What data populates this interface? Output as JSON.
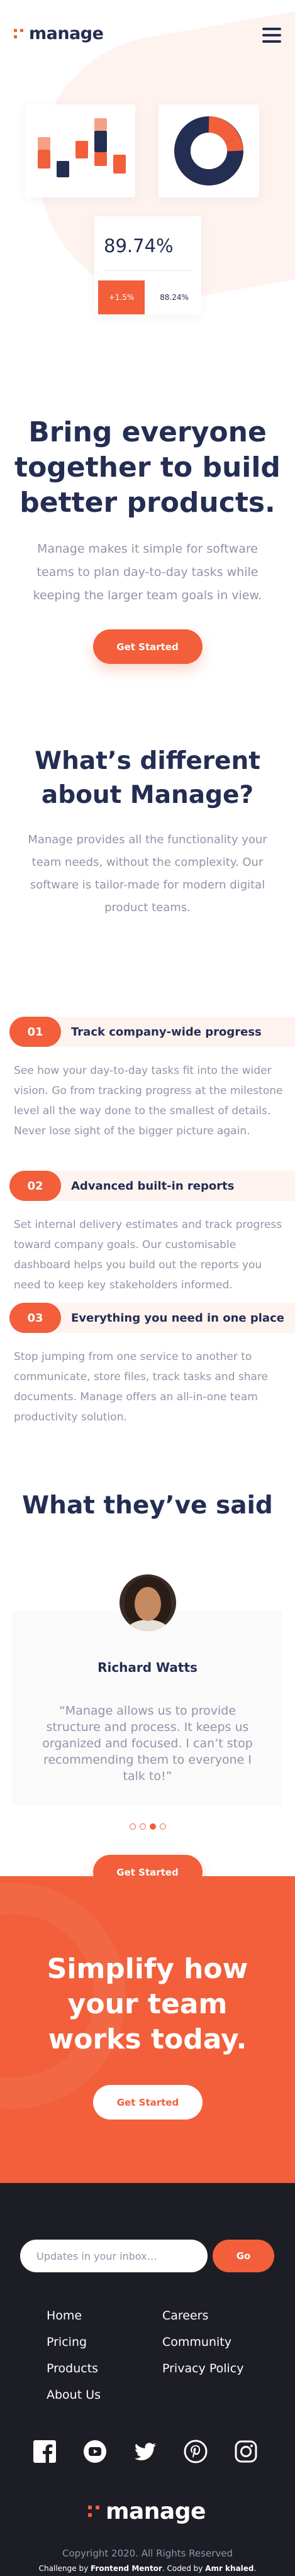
{
  "header": {
    "logo_text": "manage"
  },
  "hero": {
    "stat_main": "89.74%",
    "stat_a": "+1.5%",
    "stat_b": "88.24%",
    "title": "Bring everyone together to build better products.",
    "subtitle": "Manage makes it simple for software teams to plan day-to-day tasks while keeping the larger team goals in view.",
    "button": "Get Started"
  },
  "different": {
    "title": "What’s different about Manage?",
    "subtitle": "Manage provides all the functionality your team needs, without the complexity. Our software is tailor-made for modern digital product teams."
  },
  "features": [
    {
      "num": "01",
      "title": "Track company-wide progress",
      "desc": "See how your day-to-day tasks fit into the wider vision. Go from tracking progress at the milestone level all the way done to the smallest of details. Never lose sight of the bigger picture again."
    },
    {
      "num": "02",
      "title": "Advanced built-in reports",
      "desc": "Set internal delivery estimates and track progress toward company goals. Our customisable dashboard helps you build out the reports you need to keep key stakeholders informed."
    },
    {
      "num": "03",
      "title": "Everything you need in one place",
      "desc": "Stop jumping from one service to another to communicate, store files, track tasks and share documents. Manage offers an all-in-one team productivity solution."
    }
  ],
  "testimonials": {
    "title": "What they’ve said",
    "name": "Richard Watts",
    "quote": "“Manage allows us to provide structure and process. It keeps us organized and focused. I can’t stop recommending them to everyone I talk to!”",
    "active_dot": 3,
    "dot_count": 4,
    "button": "Get Started"
  },
  "cta": {
    "title": "Simplify how your team works today.",
    "button": "Get Started"
  },
  "footer": {
    "newsletter_placeholder": "Updates in your inbox…",
    "go_label": "Go",
    "links": [
      "Home",
      "Careers",
      "Pricing",
      "Community",
      "Products",
      "Privacy Policy",
      "About Us"
    ],
    "socials": [
      "facebook-icon",
      "youtube-icon",
      "twitter-icon",
      "pinterest-icon",
      "instagram-icon"
    ],
    "logo_text": "manage",
    "copyright": "Copyright 2020. All Rights Reserved",
    "attribution_prefix": "Challenge by",
    "attribution_org": "Frontend Mentor",
    "attribution_mid": ". Coded by",
    "attribution_author": "Amr khaled",
    "attribution_suffix": "."
  },
  "colors": {
    "accent": "#f25f3a",
    "navy": "#242d52",
    "muted": "#9095a7",
    "tint": "#fff3ef",
    "footer_bg": "#1d1e25"
  }
}
